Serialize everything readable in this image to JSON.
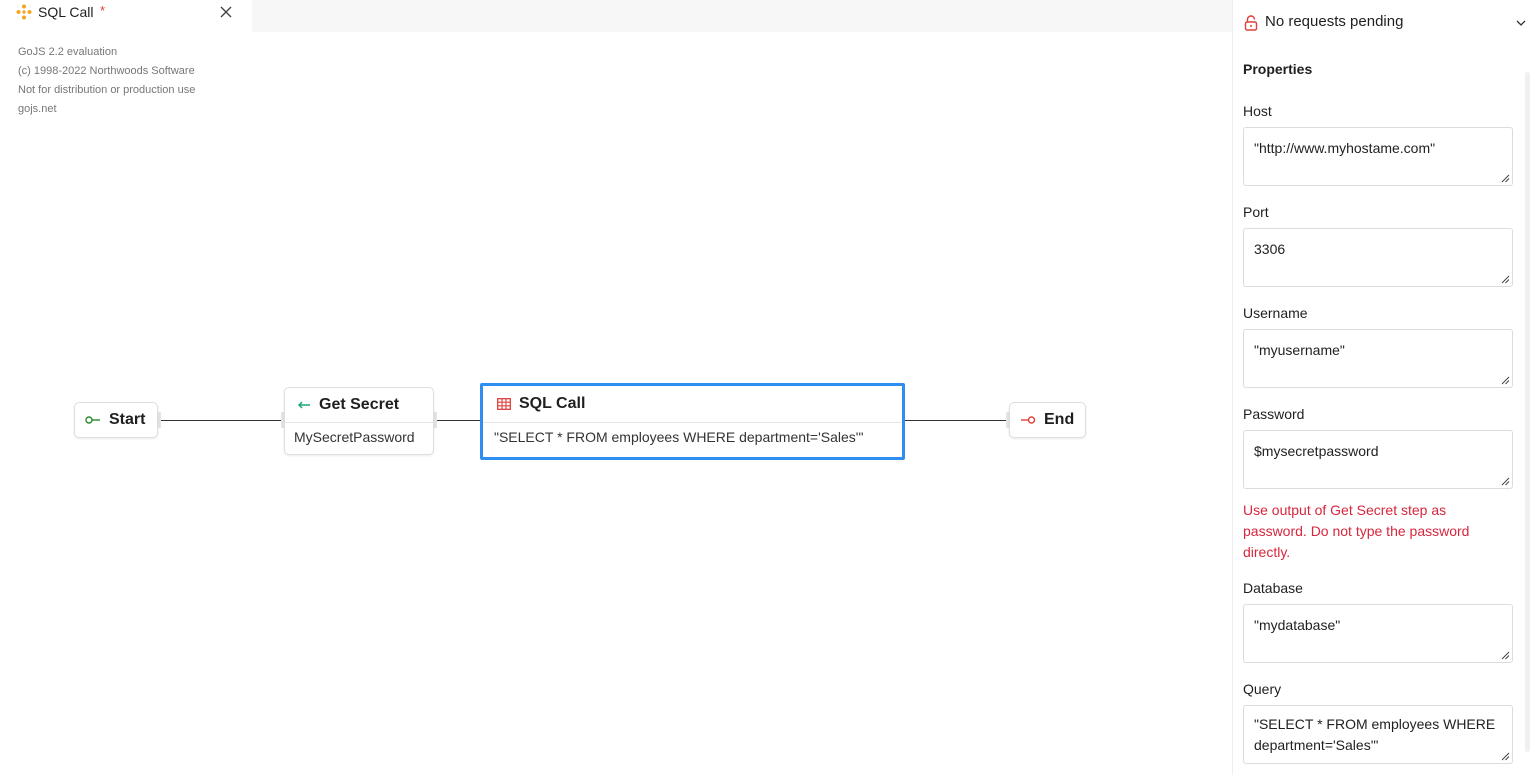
{
  "tab": {
    "title": "SQL Call",
    "dirty_marker": "*"
  },
  "watermark": [
    "GoJS 2.2 evaluation",
    "(c) 1998-2022 Northwoods Software",
    "Not for distribution or production use",
    "gojs.net"
  ],
  "diagram": {
    "nodes": [
      {
        "id": "start",
        "label": "Start",
        "icon": "start-icon"
      },
      {
        "id": "get-secret",
        "label": "Get Secret",
        "subtitle": "MySecretPassword",
        "icon": "arrow-left-icon"
      },
      {
        "id": "sql-call",
        "label": "SQL Call",
        "subtitle": "\"SELECT * FROM employees WHERE department='Sales'\"",
        "icon": "table-icon",
        "selected": true
      },
      {
        "id": "end",
        "label": "End",
        "icon": "end-icon"
      }
    ]
  },
  "panel": {
    "requests": "No requests pending",
    "title": "Properties",
    "fields": [
      {
        "label": "Host",
        "value": "\"http://www.myhostame.com\""
      },
      {
        "label": "Port",
        "value": "3306"
      },
      {
        "label": "Username",
        "value": "\"myusername\""
      },
      {
        "label": "Password",
        "value": "$mysecretpassword"
      },
      {
        "label": "Database",
        "value": "\"mydatabase\""
      },
      {
        "label": "Query",
        "value": "\"SELECT * FROM employees WHERE department='Sales'\""
      }
    ],
    "password_error": "Use output of Get Secret step as password. Do not type the password directly."
  },
  "colors": {
    "accent": "#2f8ff0",
    "error": "#d7263d",
    "start": "#2a8a2a",
    "end": "#e0403b",
    "secret": "#1aa37a",
    "sql": "#e0403b",
    "tab_icon": "#f5a623"
  }
}
